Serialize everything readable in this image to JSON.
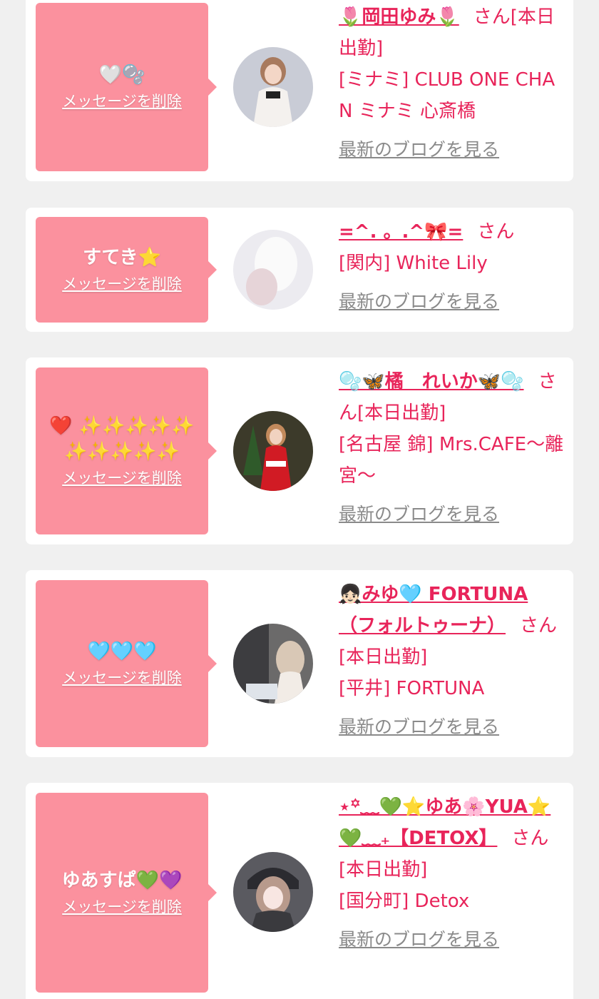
{
  "delete_label": "メッセージを削除",
  "blog_label": "最新のブログを見る",
  "colors": {
    "bubble": "#fb919e",
    "accent": "#e8245a",
    "link_gray": "#8a8a8a",
    "background": "#f0f0f0"
  },
  "items": [
    {
      "message": "🤍🫧",
      "name": "🌷岡田ゆみ🌷",
      "suffix": "さん",
      "status": "[本日出勤]",
      "shop": "[ミナミ] CLUB ONE CHAN ミナミ 心斎橋"
    },
    {
      "message": "すてき⭐️",
      "name": "=^. 。.^🎀=",
      "suffix": "さん",
      "status": "",
      "shop": "[関内] White Lily"
    },
    {
      "message": "❤️ ✨✨✨✨✨✨✨✨✨✨",
      "name": "🫧🦋橘　れいか🦋🫧",
      "suffix": "さん",
      "status": "[本日出勤]",
      "shop": "[名古屋 錦] Mrs.CAFE〜離宮〜"
    },
    {
      "message": "🩵🩵🩵",
      "name": "👧🏻みゆ🩵 FORTUNA（フォルトゥーナ）",
      "suffix": "さん",
      "status": "[本日出勤]",
      "shop": "[平井] FORTUNA"
    },
    {
      "message": "ゆあすぱ💚💜",
      "name": "⋆꙳﹏💚⭐️ゆあ🌸YUA⭐️💚﹏₊【DETOX】",
      "suffix": "さん",
      "status": "[本日出勤]",
      "shop": "[国分町] Detox"
    }
  ]
}
